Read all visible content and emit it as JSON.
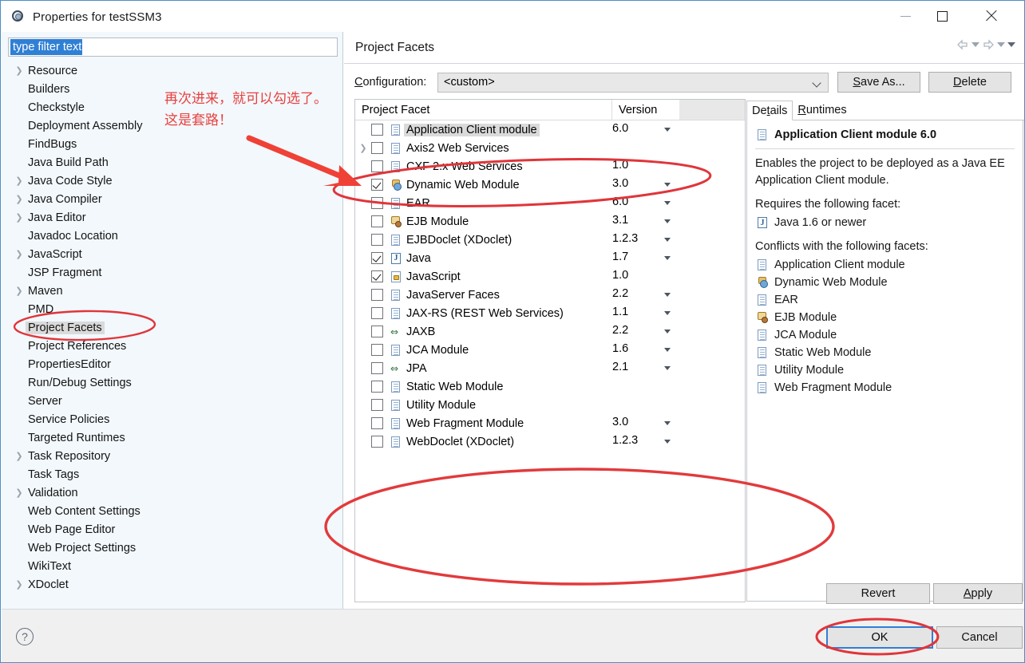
{
  "window": {
    "title": "Properties for testSSM3",
    "icon": "eclipse-properties-icon",
    "minimize": "minimize-icon",
    "maximize": "maximize-icon",
    "close": "close-icon"
  },
  "filter": {
    "value": "type filter text",
    "placeholder": "type filter text"
  },
  "tree": {
    "items": [
      {
        "label": "Resource",
        "expandable": true,
        "selected": false
      },
      {
        "label": "Builders",
        "expandable": false,
        "selected": false
      },
      {
        "label": "Checkstyle",
        "expandable": false,
        "selected": false
      },
      {
        "label": "Deployment Assembly",
        "expandable": false,
        "selected": false
      },
      {
        "label": "FindBugs",
        "expandable": false,
        "selected": false
      },
      {
        "label": "Java Build Path",
        "expandable": false,
        "selected": false
      },
      {
        "label": "Java Code Style",
        "expandable": true,
        "selected": false
      },
      {
        "label": "Java Compiler",
        "expandable": true,
        "selected": false
      },
      {
        "label": "Java Editor",
        "expandable": true,
        "selected": false
      },
      {
        "label": "Javadoc Location",
        "expandable": false,
        "selected": false
      },
      {
        "label": "JavaScript",
        "expandable": true,
        "selected": false
      },
      {
        "label": "JSP Fragment",
        "expandable": false,
        "selected": false
      },
      {
        "label": "Maven",
        "expandable": true,
        "selected": false
      },
      {
        "label": "PMD",
        "expandable": false,
        "selected": false
      },
      {
        "label": "Project Facets",
        "expandable": false,
        "selected": true
      },
      {
        "label": "Project References",
        "expandable": false,
        "selected": false
      },
      {
        "label": "PropertiesEditor",
        "expandable": false,
        "selected": false
      },
      {
        "label": "Run/Debug Settings",
        "expandable": false,
        "selected": false
      },
      {
        "label": "Server",
        "expandable": false,
        "selected": false
      },
      {
        "label": "Service Policies",
        "expandable": false,
        "selected": false
      },
      {
        "label": "Targeted Runtimes",
        "expandable": false,
        "selected": false
      },
      {
        "label": "Task Repository",
        "expandable": true,
        "selected": false
      },
      {
        "label": "Task Tags",
        "expandable": false,
        "selected": false
      },
      {
        "label": "Validation",
        "expandable": true,
        "selected": false
      },
      {
        "label": "Web Content Settings",
        "expandable": false,
        "selected": false
      },
      {
        "label": "Web Page Editor",
        "expandable": false,
        "selected": false
      },
      {
        "label": "Web Project Settings",
        "expandable": false,
        "selected": false
      },
      {
        "label": "WikiText",
        "expandable": false,
        "selected": false
      },
      {
        "label": "XDoclet",
        "expandable": true,
        "selected": false
      }
    ]
  },
  "page": {
    "title": "Project Facets",
    "nav": {
      "back": "back-arrow-icon",
      "back_menu": "back-dropdown-icon",
      "forward": "forward-arrow-icon",
      "forward_menu": "forward-dropdown-icon",
      "menu": "view-menu-icon"
    }
  },
  "configuration": {
    "label": "Configuration:",
    "label_mnemonic": "C",
    "value": "<custom>",
    "dropdown_icon": "chevron-down-icon",
    "save_as_label": "Save As...",
    "save_as_mnemonic": "S",
    "delete_label": "Delete",
    "delete_mnemonic": "D"
  },
  "facet_table": {
    "columns": [
      "Project Facet",
      "Version"
    ],
    "rows": [
      {
        "name": "Application Client module",
        "version": "6.0",
        "checked": false,
        "expandable": false,
        "icon": "doc-icon",
        "has_version_caret": true,
        "selected": true
      },
      {
        "name": "Axis2 Web Services",
        "version": "",
        "checked": false,
        "expandable": true,
        "icon": "doc-icon",
        "has_version_caret": false,
        "selected": false
      },
      {
        "name": "CXF 2.x Web Services",
        "version": "1.0",
        "checked": false,
        "expandable": false,
        "icon": "doc-icon",
        "has_version_caret": false,
        "selected": false
      },
      {
        "name": "Dynamic Web Module",
        "version": "3.0",
        "checked": true,
        "expandable": false,
        "icon": "web-icon",
        "has_version_caret": true,
        "selected": false
      },
      {
        "name": "EAR",
        "version": "6.0",
        "checked": false,
        "expandable": false,
        "icon": "doc-icon",
        "has_version_caret": true,
        "selected": false
      },
      {
        "name": "EJB Module",
        "version": "3.1",
        "checked": false,
        "expandable": false,
        "icon": "ejb-icon",
        "has_version_caret": true,
        "selected": false
      },
      {
        "name": "EJBDoclet (XDoclet)",
        "version": "1.2.3",
        "checked": false,
        "expandable": false,
        "icon": "doc-icon",
        "has_version_caret": true,
        "selected": false
      },
      {
        "name": "Java",
        "version": "1.7",
        "checked": true,
        "expandable": false,
        "icon": "java-icon",
        "has_version_caret": true,
        "selected": false
      },
      {
        "name": "JavaScript",
        "version": "1.0",
        "checked": true,
        "expandable": false,
        "icon": "javascript-icon",
        "has_version_caret": false,
        "selected": false
      },
      {
        "name": "JavaServer Faces",
        "version": "2.2",
        "checked": false,
        "expandable": false,
        "icon": "doc-icon",
        "has_version_caret": true,
        "selected": false
      },
      {
        "name": "JAX-RS (REST Web Services)",
        "version": "1.1",
        "checked": false,
        "expandable": false,
        "icon": "doc-icon",
        "has_version_caret": true,
        "selected": false
      },
      {
        "name": "JAXB",
        "version": "2.2",
        "checked": false,
        "expandable": false,
        "icon": "arrows-icon",
        "has_version_caret": true,
        "selected": false
      },
      {
        "name": "JCA Module",
        "version": "1.6",
        "checked": false,
        "expandable": false,
        "icon": "doc-icon",
        "has_version_caret": true,
        "selected": false
      },
      {
        "name": "JPA",
        "version": "2.1",
        "checked": false,
        "expandable": false,
        "icon": "arrows-icon",
        "has_version_caret": true,
        "selected": false
      },
      {
        "name": "Static Web Module",
        "version": "",
        "checked": false,
        "expandable": false,
        "icon": "doc-icon",
        "has_version_caret": false,
        "selected": false
      },
      {
        "name": "Utility Module",
        "version": "",
        "checked": false,
        "expandable": false,
        "icon": "doc-icon",
        "has_version_caret": false,
        "selected": false
      },
      {
        "name": "Web Fragment Module",
        "version": "3.0",
        "checked": false,
        "expandable": false,
        "icon": "doc-icon",
        "has_version_caret": true,
        "selected": false
      },
      {
        "name": "WebDoclet (XDoclet)",
        "version": "1.2.3",
        "checked": false,
        "expandable": false,
        "icon": "doc-icon",
        "has_version_caret": true,
        "selected": false
      }
    ]
  },
  "details": {
    "tabs": [
      {
        "label": "Details",
        "mnemonic": "t",
        "active": true
      },
      {
        "label": "Runtimes",
        "mnemonic": "R",
        "active": false
      }
    ],
    "title": "Application Client module 6.0",
    "title_icon": "doc-icon",
    "description": "Enables the project to be deployed as a Java EE Application Client module.",
    "requires_heading": "Requires the following facet:",
    "requires": [
      {
        "label": "Java 1.6 or newer",
        "icon": "java-icon"
      }
    ],
    "conflicts_heading": "Conflicts with the following facets:",
    "conflicts": [
      {
        "label": "Application Client module",
        "icon": "doc-icon"
      },
      {
        "label": "Dynamic Web Module",
        "icon": "web-icon"
      },
      {
        "label": "EAR",
        "icon": "doc-icon"
      },
      {
        "label": "EJB Module",
        "icon": "ejb-icon"
      },
      {
        "label": "JCA Module",
        "icon": "doc-icon"
      },
      {
        "label": "Static Web Module",
        "icon": "doc-icon"
      },
      {
        "label": "Utility Module",
        "icon": "doc-icon"
      },
      {
        "label": "Web Fragment Module",
        "icon": "doc-icon"
      }
    ]
  },
  "buttons": {
    "revert": "Revert",
    "apply": "Apply",
    "apply_mnemonic": "A",
    "ok": "OK",
    "cancel": "Cancel",
    "help": "?"
  },
  "annotations": {
    "note_line1": "再次进来，就可以勾选了。",
    "note_line2": "这是套路！",
    "color": "#e8413f"
  }
}
